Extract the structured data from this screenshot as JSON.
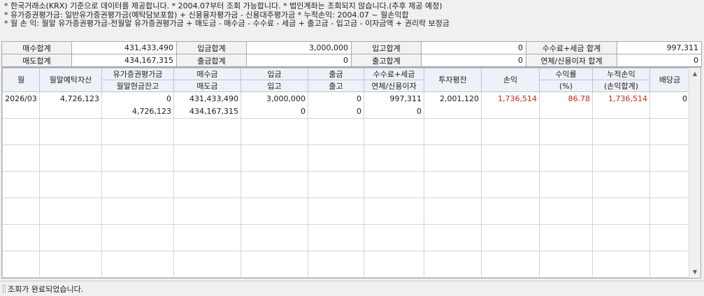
{
  "notes": [
    "* 한국거래소(KRX) 기준으로 데이터를 제공합니다.  * 2004.07부터 조회 가능합니다.  * 법인계좌는 조회되지 않습니다.(추후 제공 예정)",
    "* 유가증권평가금: 일반유가증권평가금(예탁담보포함) + 신용융자평가금 - 신용대주평가금  * 누적손익: 2004.07 ~ 월손익합",
    "* 월 손 익: 월말 유가증권평가금-전월말 유가증권평가금 + 매도금 - 매수금 - 수수료 - 세금 + 출고금 - 입고금 - 이자금액 + 권리락 보정금"
  ],
  "summary": {
    "buy_total_label": "매수합계",
    "buy_total": "431,433,490",
    "deposit_total_label": "입금합계",
    "deposit_total": "3,000,000",
    "stock_in_total_label": "입고합계",
    "stock_in_total": "0",
    "fee_tax_total_label": "수수료+세금 합계",
    "fee_tax_total": "997,311",
    "sell_total_label": "매도합계",
    "sell_total": "434,167,315",
    "withdraw_total_label": "출금합계",
    "withdraw_total": "0",
    "stock_out_total_label": "출고합계",
    "stock_out_total": "0",
    "interest_total_label": "연체/신용이자 합계",
    "interest_total": "0"
  },
  "headers": {
    "month": "월",
    "month_end_assets": "월말예탁자산",
    "securities_eval_top": "유가증권평가금",
    "securities_eval_bottom": "월말현금잔고",
    "buy_top": "매수금",
    "buy_bottom": "매도금",
    "deposit_top": "입금",
    "deposit_bottom": "입고",
    "withdraw_top": "출금",
    "withdraw_bottom": "출고",
    "fee_top": "수수료+세금",
    "fee_bottom": "연체/신용이자",
    "avg_investment": "투자평잔",
    "pnl": "손익",
    "return_top": "수익률",
    "return_bottom": "(%)",
    "cum_pnl_top": "누적손익",
    "cum_pnl_bottom": "(손익합계)",
    "dividend": "배당금"
  },
  "rows": [
    {
      "month": "2026/03",
      "month_end_assets": "4,726,123",
      "securities_eval": "0",
      "month_end_cash": "4,726,123",
      "buy": "431,433,490",
      "sell": "434,167,315",
      "deposit": "3,000,000",
      "stock_in": "0",
      "withdraw": "0",
      "stock_out": "0",
      "fee_tax": "997,311",
      "interest": "0",
      "avg_investment": "2,001,120",
      "pnl": "1,736,514",
      "return_pct": "86.78",
      "cum_pnl": "1,736,514",
      "dividend": "0"
    }
  ],
  "colors": {
    "header_bg": "#eef1f8",
    "positive": "#d42020"
  },
  "status": {
    "message": "조회가 완료되었습니다."
  },
  "icons": {
    "scroll_up": "triangle-up",
    "scroll_down": "triangle-down"
  }
}
